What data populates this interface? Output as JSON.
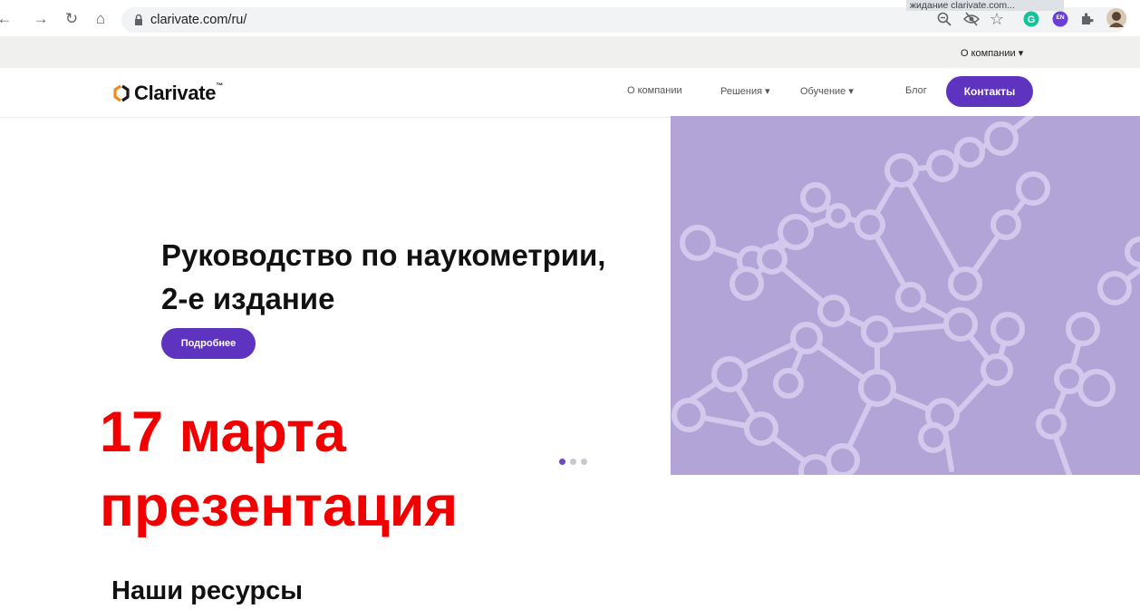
{
  "browser": {
    "url": "clarivate.com/ru/",
    "status_popup": "жидание clarivate.com...",
    "nav_icons": [
      "back-arrow-icon",
      "forward-arrow-icon",
      "reload-icon",
      "home-icon",
      "lock-icon"
    ],
    "toolbar_icons": [
      "zoom-icon",
      "eye-off-icon",
      "star-icon",
      "grammarly-icon",
      "translate-extension-icon",
      "puzzle-icon",
      "profile-avatar"
    ],
    "extension_label": "EN"
  },
  "page": {
    "top_about": "О компании ▾",
    "logo": "Clarivate",
    "logo_tm": "™",
    "nav": {
      "about": "О компании",
      "solutions": "Решения ▾",
      "learning": "Обучение ▾",
      "blog": "Блог",
      "contacts": "Контакты"
    },
    "hero": {
      "title": "Руководство по наукометрии, 2-е издание",
      "button": "Подробнее"
    },
    "overlay": {
      "line1": "17 марта",
      "line2": "презентация"
    },
    "resources_heading": "Наши ресурсы"
  },
  "colors": {
    "brand_purple": "#5e33bf",
    "hero_image_bg": "#b3a4d8",
    "overlay_red": "#f20000"
  }
}
